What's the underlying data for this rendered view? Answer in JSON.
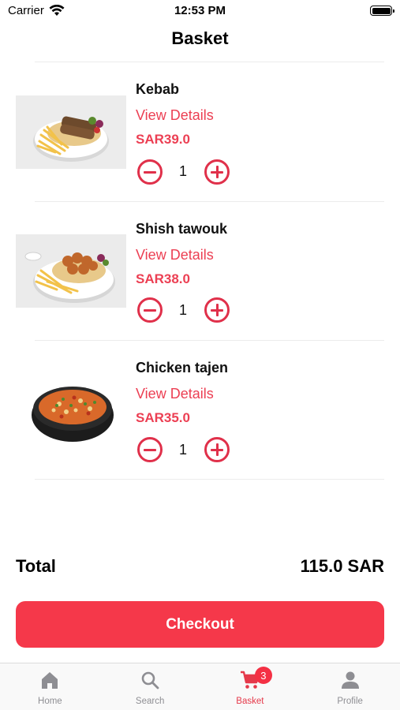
{
  "status_bar": {
    "carrier": "Carrier",
    "time": "12:53 PM"
  },
  "header": {
    "title": "Basket"
  },
  "items": [
    {
      "name": "Kebab",
      "view_details": "View Details",
      "price": "SAR39.0",
      "quantity": "1",
      "image": "kebab-plate"
    },
    {
      "name": "Shish tawouk",
      "view_details": "View Details",
      "price": "SAR38.0",
      "quantity": "1",
      "image": "shish-tawouk-plate"
    },
    {
      "name": "Chicken tajen",
      "view_details": "View Details",
      "price": "SAR35.0",
      "quantity": "1",
      "image": "chicken-tajen-pot"
    }
  ],
  "total": {
    "label": "Total",
    "value": "115.0 SAR"
  },
  "checkout": {
    "label": "Checkout"
  },
  "tab_bar": {
    "tabs": [
      {
        "label": "Home",
        "icon": "home-icon",
        "active": false
      },
      {
        "label": "Search",
        "icon": "search-icon",
        "active": false
      },
      {
        "label": "Basket",
        "icon": "cart-icon",
        "active": true,
        "badge": "3"
      },
      {
        "label": "Profile",
        "icon": "profile-icon",
        "active": false
      }
    ]
  },
  "colors": {
    "accent": "#f5384a",
    "price": "#ec3f53",
    "inactive_tab": "#8e8e93"
  }
}
